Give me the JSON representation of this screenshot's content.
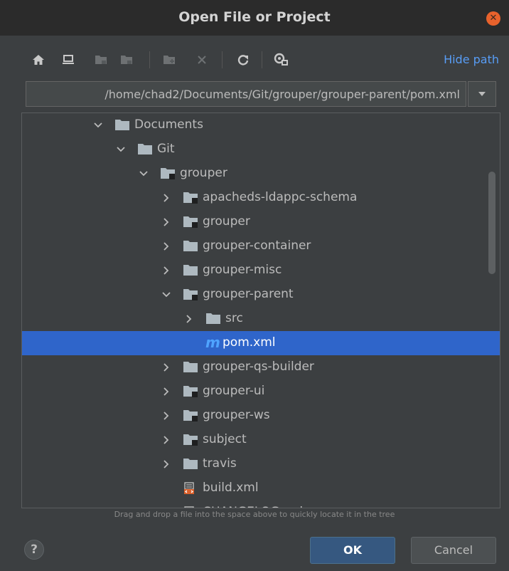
{
  "window": {
    "title": "Open File or Project",
    "close_icon": "close-icon"
  },
  "toolbar": {
    "buttons": [
      {
        "name": "home-icon"
      },
      {
        "name": "desktop-icon"
      },
      {
        "name": "project-folder-icon"
      },
      {
        "name": "module-folder-icon"
      },
      {
        "name": "new-folder-icon"
      },
      {
        "name": "delete-icon"
      },
      {
        "name": "refresh-icon"
      },
      {
        "name": "show-hidden-icon"
      }
    ],
    "hide_path": "Hide path"
  },
  "path": {
    "value": "/home/chad2/Documents/Git/grouper/grouper-parent/pom.xml"
  },
  "tree": {
    "rows": [
      {
        "label": "Documents",
        "expanded": true,
        "icon": "folder-icon"
      },
      {
        "label": "Git",
        "expanded": true,
        "icon": "folder-icon"
      },
      {
        "label": "grouper",
        "expanded": true,
        "icon": "module-folder-icon"
      },
      {
        "label": "apacheds-ldappc-schema",
        "expanded": false,
        "icon": "module-folder-icon"
      },
      {
        "label": "grouper",
        "expanded": false,
        "icon": "module-folder-icon"
      },
      {
        "label": "grouper-container",
        "expanded": false,
        "icon": "folder-icon"
      },
      {
        "label": "grouper-misc",
        "expanded": false,
        "icon": "folder-icon"
      },
      {
        "label": "grouper-parent",
        "expanded": true,
        "icon": "module-folder-icon"
      },
      {
        "label": "src",
        "expanded": false,
        "icon": "folder-icon"
      },
      {
        "label": "pom.xml",
        "icon": "maven-icon",
        "selected": true,
        "mvn_letter": "m"
      },
      {
        "label": "grouper-qs-builder",
        "expanded": false,
        "icon": "folder-icon"
      },
      {
        "label": "grouper-ui",
        "expanded": false,
        "icon": "module-folder-icon"
      },
      {
        "label": "grouper-ws",
        "expanded": false,
        "icon": "module-folder-icon"
      },
      {
        "label": "subject",
        "expanded": false,
        "icon": "module-folder-icon"
      },
      {
        "label": "travis",
        "expanded": false,
        "icon": "folder-icon"
      },
      {
        "label": "build.xml",
        "icon": "ant-build-icon"
      },
      {
        "label": "CHANGELOG.md",
        "icon": "markdown-file-icon"
      }
    ]
  },
  "hint": "Drag and drop a file into the space above to quickly locate it in the tree",
  "buttons": {
    "help": "?",
    "ok": "OK",
    "cancel": "Cancel"
  },
  "colors": {
    "background": "#3c3f41",
    "selection": "#2f65ca",
    "accent": "#589df6",
    "ok_button": "#365880",
    "close": "#e8622c"
  }
}
